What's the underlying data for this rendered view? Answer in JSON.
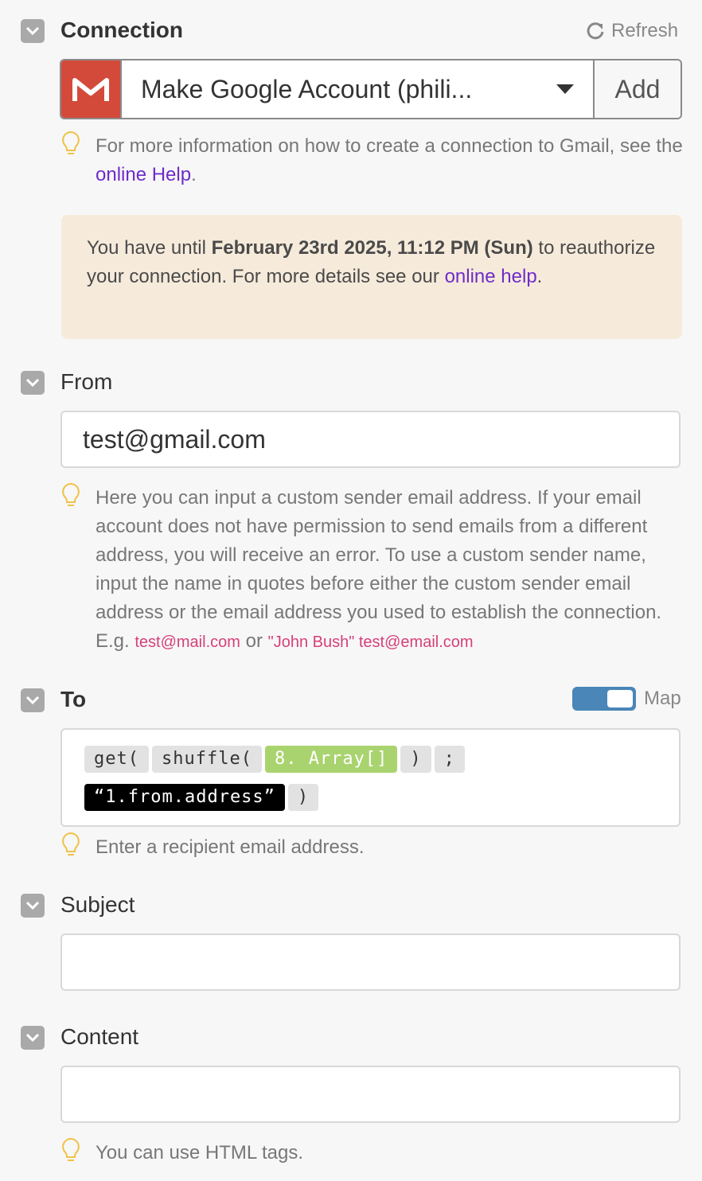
{
  "connection": {
    "label": "Connection",
    "refresh_label": "Refresh",
    "selected_account": "Make Google Account (phili...",
    "add_label": "Add",
    "hint_prefix": "For more information on how to create a connection to Gmail, see the ",
    "hint_link": "online Help",
    "hint_suffix": ".",
    "warning": {
      "prefix": "You have until ",
      "deadline": "February 23rd 2025, 11:12 PM (Sun)",
      "middle": " to reauthorize your connection. For more details see our ",
      "link": "online help",
      "suffix": "."
    },
    "brand_color": "#d44a3a"
  },
  "from": {
    "label": "From",
    "value": "test@gmail.com",
    "hint": "Here you can input a custom sender email address. If your email account does not have permission to send emails from a different address, you will receive an error. To use a custom sender name, input the name in quotes before either the custom sender email address or the email address you used to establish the connection. E.g. ",
    "example1": "test@mail.com",
    "or": " or ",
    "example2": "\"John Bush\" test@email.com"
  },
  "to": {
    "label": "To",
    "map_label": "Map",
    "map_enabled": true,
    "tokens": [
      "get(",
      "shuffle(",
      "8. Array[]",
      ")",
      ";",
      "“1.from.address”",
      ")"
    ],
    "hint": "Enter a recipient email address."
  },
  "subject": {
    "label": "Subject",
    "value": ""
  },
  "content": {
    "label": "Content",
    "value": "",
    "hint": "You can use HTML tags."
  },
  "colors": {
    "toggle": "#4a86b8",
    "warning_bg": "#f6ebdb",
    "link": "#6f2cc9",
    "pill_green": "#a9d36e"
  }
}
